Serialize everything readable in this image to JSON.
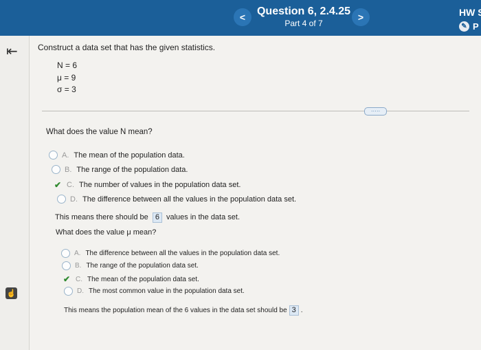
{
  "header": {
    "question_title": "Question 6, 2.4.25",
    "part": "Part 4 of 7",
    "prev_label": "<",
    "next_label": ">",
    "hw_label": "HW S",
    "hw_sub": "P"
  },
  "prompt": "Construct a data set that has the given statistics.",
  "stats": [
    "N = 6",
    "μ = 9",
    "σ = 3"
  ],
  "more_button": "·····",
  "q1": {
    "text": "What does the value N mean?",
    "options": [
      {
        "letter": "A.",
        "text": "The mean of the population data.",
        "selected": false
      },
      {
        "letter": "B.",
        "text": "The range of the population data.",
        "selected": false
      },
      {
        "letter": "C.",
        "text": "The number of values in the population data set.",
        "selected": true
      },
      {
        "letter": "D.",
        "text": "The difference between all the values in the population data set.",
        "selected": false
      }
    ]
  },
  "statement1": {
    "before": "This means there should be",
    "value": "6",
    "after": "values in the data set."
  },
  "q2": {
    "text": "What does the value μ mean?",
    "options": [
      {
        "letter": "A.",
        "text": "The difference between all the values in the population data set.",
        "selected": false
      },
      {
        "letter": "B.",
        "text": "The range of the population data set.",
        "selected": false
      },
      {
        "letter": "C.",
        "text": "The mean of the population data set.",
        "selected": true
      },
      {
        "letter": "D.",
        "text": "The most common value in the population data set.",
        "selected": false
      }
    ]
  },
  "statement2": {
    "before": "This means the population mean of the 6 values in the data set should be",
    "value": "3",
    "after": "."
  },
  "colors": {
    "header": "#1b5f99",
    "check": "#2f8a2f"
  }
}
